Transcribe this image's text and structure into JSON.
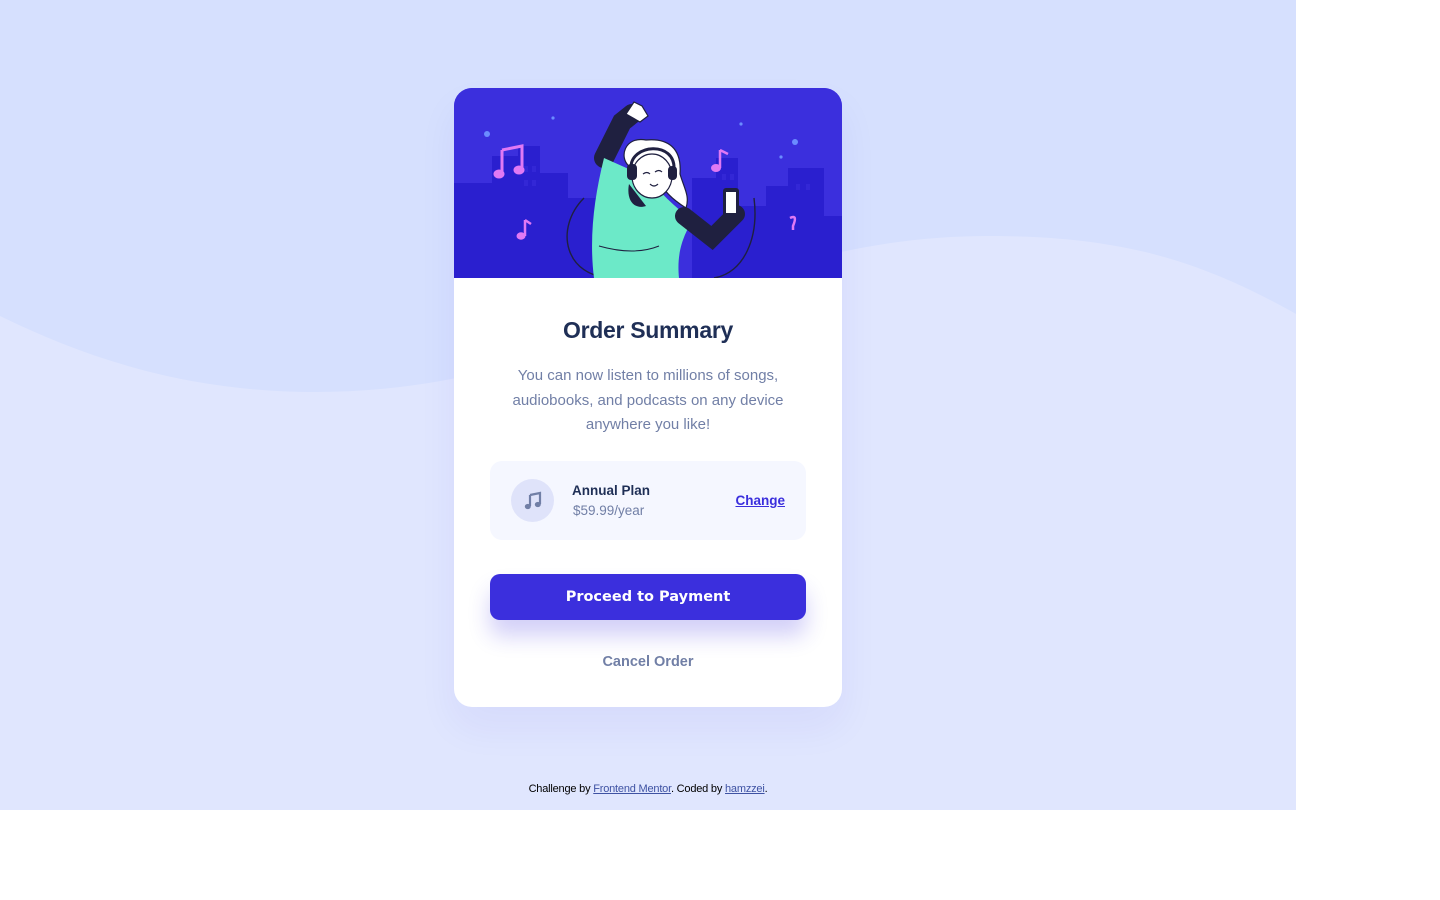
{
  "card": {
    "title": "Order Summary",
    "description": "You can now listen to millions of songs, audiobooks, and podcasts on any device anywhere you like!",
    "hero_illustration": "person-dancing-with-headphones-and-phone",
    "plan": {
      "icon": "music-note-icon",
      "name": "Annual Plan",
      "price": "$59.99/year",
      "change_label": "Change"
    },
    "pay_label": "Proceed to Payment",
    "cancel_label": "Cancel Order"
  },
  "attribution": {
    "prefix": "Challenge by ",
    "link1": "Frontend Mentor",
    "middle": ". Coded by ",
    "link2": "hamzzei",
    "suffix": "."
  },
  "colors": {
    "page_bg": "#e0e6fe",
    "wave": "#d6e0fe",
    "primary": "#3b2fdd",
    "heading": "#1f2f56",
    "muted": "#717fa6",
    "plan_bg": "#f5f7ff"
  }
}
